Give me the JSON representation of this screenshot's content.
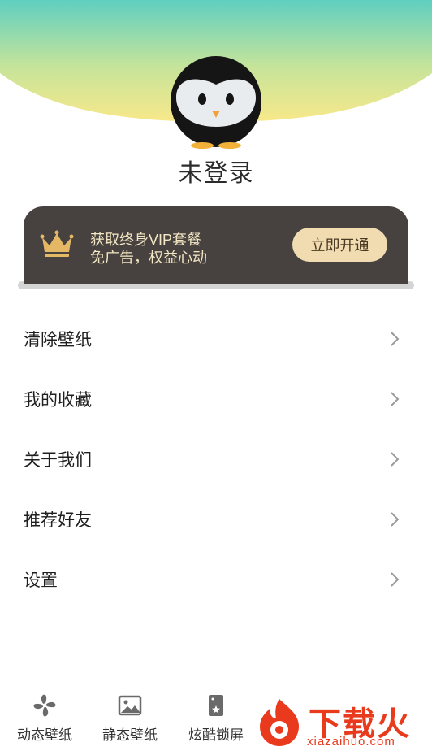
{
  "profile": {
    "username": "未登录"
  },
  "vip": {
    "title": "获取终身VIP套餐",
    "subtitle": "免广告，权益心动",
    "button_label": "立即开通"
  },
  "menu": {
    "items": [
      {
        "label": "清除壁纸"
      },
      {
        "label": "我的收藏"
      },
      {
        "label": "关于我们"
      },
      {
        "label": "推荐好友"
      },
      {
        "label": "设置"
      }
    ]
  },
  "tabbar": {
    "tabs": [
      {
        "label": "动态壁纸",
        "icon": "fan-icon"
      },
      {
        "label": "静态壁纸",
        "icon": "image-icon"
      },
      {
        "label": "炫酷锁屏",
        "icon": "lock-screen-card-icon"
      }
    ]
  },
  "watermark": {
    "text": "下载火",
    "url": "xiazaihuo.com"
  },
  "colors": {
    "header_top": "#5fcfc0",
    "header_bottom": "#f6e78c",
    "vip_card": "#474240",
    "vip_text": "#f4e7c3",
    "vip_button": "#f0dcb0",
    "watermark": "#ea3a1e"
  }
}
